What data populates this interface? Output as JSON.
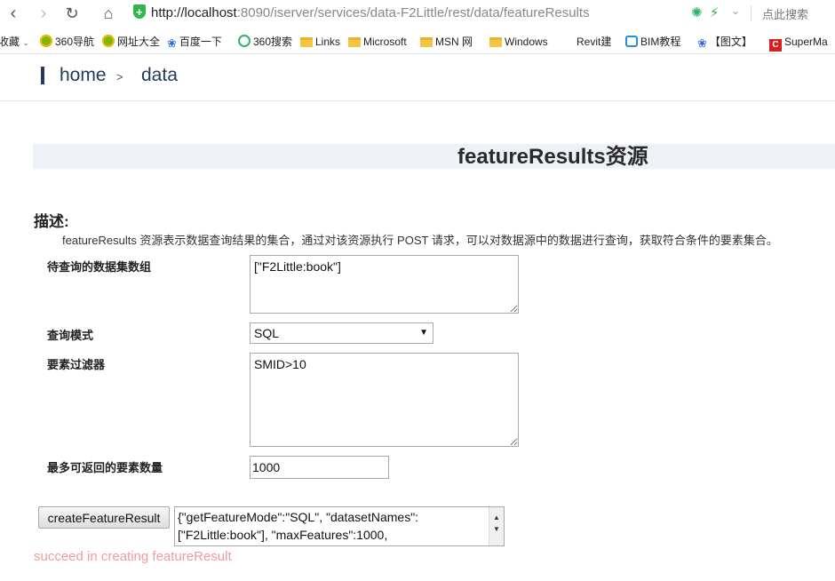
{
  "browser": {
    "url_host": "http://localhost",
    "url_rest": ":8090/iserver/services/data-F2Little/rest/data/featureResults",
    "search_hint": "点此搜索",
    "bookmarks": [
      {
        "label": "收藏",
        "icon": "chevron-down-icon"
      },
      {
        "label": "360导航",
        "icon": "360-nav-icon"
      },
      {
        "label": "网址大全",
        "icon": "360-nav-icon"
      },
      {
        "label": "百度一下",
        "icon": "baidu-paw-icon"
      },
      {
        "label": "360搜索",
        "icon": "360-search-icon"
      },
      {
        "label": "Links",
        "icon": "folder-icon"
      },
      {
        "label": "Microsoft",
        "icon": "folder-icon"
      },
      {
        "label": "MSN 网",
        "icon": "folder-icon"
      },
      {
        "label": "Windows",
        "icon": "folder-icon"
      },
      {
        "label": "Revit建",
        "icon": ""
      },
      {
        "label": "BIM教程",
        "icon": "bim-icon"
      },
      {
        "label": "【图文】",
        "icon": "baidu-paw-icon"
      },
      {
        "label": "SuperMa",
        "icon": "supermap-icon"
      }
    ]
  },
  "breadcrumb": {
    "home": "home",
    "separator": ">",
    "current": "data"
  },
  "page": {
    "title": "featureResults资源",
    "description_heading": "描述:",
    "description": "featureResults 资源表示数据查询结果的集合，通过对该资源执行 POST 请求，可以对数据源中的数据进行查询，获取符合条件的要素集合。"
  },
  "form": {
    "datasets_label": "待查询的数据集数组",
    "datasets_value": "[\"F2Little:book\"]",
    "mode_label": "查询模式",
    "mode_value": "SQL",
    "filter_label": "要素过滤器",
    "filter_value": "SMID>10",
    "max_label": "最多可返回的要素数量",
    "max_value": "1000"
  },
  "action": {
    "button_label": "createFeatureResult",
    "json_line1": "{\"getFeatureMode\":\"SQL\", \"datasetNames\":",
    "json_line2": "[\"F2Little:book\"], \"maxFeatures\":1000,",
    "status": "succeed in creating featureResult",
    "status_color": "#f29b9b"
  }
}
